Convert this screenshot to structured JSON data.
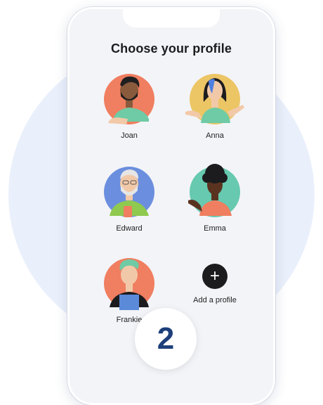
{
  "header": {
    "title": "Choose your profile"
  },
  "profiles": [
    {
      "name": "Joan",
      "bg": "#f07e60"
    },
    {
      "name": "Anna",
      "bg": "#ecc565"
    },
    {
      "name": "Edward",
      "bg": "#6b8fde"
    },
    {
      "name": "Emma",
      "bg": "#66c9b0"
    },
    {
      "name": "Frankie",
      "bg": "#f07e60"
    }
  ],
  "add_profile": {
    "label": "Add a profile",
    "icon": "+"
  },
  "step": {
    "number": "2"
  }
}
